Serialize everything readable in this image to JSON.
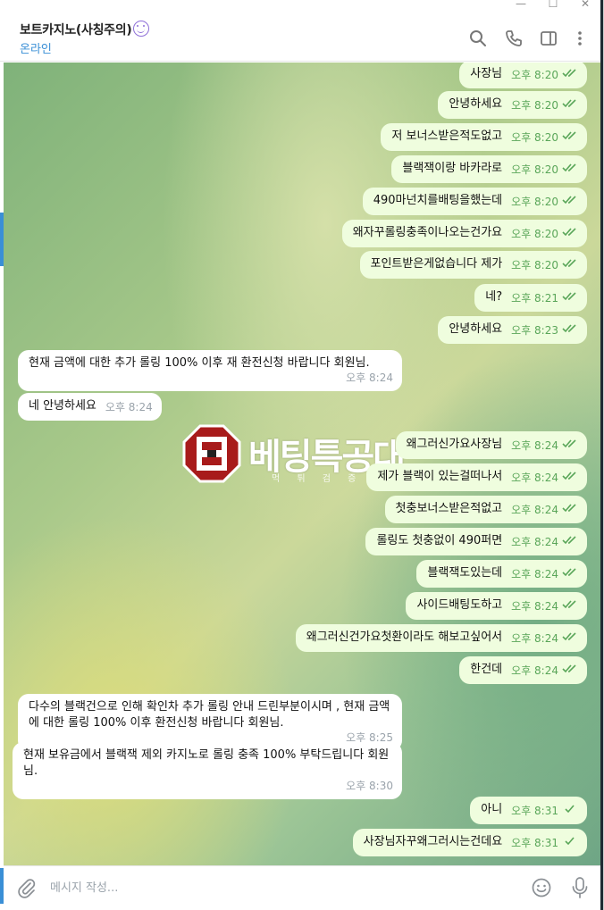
{
  "header": {
    "title": "보트카지노(사칭주의)",
    "status": "온라인",
    "icons": [
      "search-icon",
      "phone-icon",
      "sidebar-toggle-icon",
      "more-vertical-icon"
    ]
  },
  "watermark": {
    "text": "베팅특공대",
    "subtext": "먹 튀 검 증 의"
  },
  "messages": [
    {
      "dir": "out",
      "text": "사장님",
      "time": "오후 8:20",
      "read": true
    },
    {
      "dir": "out",
      "text": "안녕하세요",
      "time": "오후 8:20",
      "read": true
    },
    {
      "dir": "out",
      "text": "저 보너스받은적도없고",
      "time": "오후 8:20",
      "read": true
    },
    {
      "dir": "out",
      "text": "블랙잭이랑 바카라로",
      "time": "오후 8:20",
      "read": true
    },
    {
      "dir": "out",
      "text": "490마넌치를배팅을했는데",
      "time": "오후 8:20",
      "read": true
    },
    {
      "dir": "out",
      "text": "왜자꾸롤링충족이나오는건가요",
      "time": "오후 8:20",
      "read": true
    },
    {
      "dir": "out",
      "text": "포인트받은게없습니다 제가",
      "time": "오후 8:20",
      "read": true
    },
    {
      "dir": "out",
      "text": "네?",
      "time": "오후 8:21",
      "read": true
    },
    {
      "dir": "out",
      "text": "안녕하세요",
      "time": "오후 8:23",
      "read": true
    },
    {
      "dir": "in",
      "text": "현재 금액에 대한 추가 롤링 100% 이후 재 환전신청 바랍니다 회원님.",
      "time": "오후 8:24"
    },
    {
      "dir": "in",
      "text": "네 안녕하세요",
      "time": "오후 8:24"
    },
    {
      "dir": "out",
      "text": "왜그러신가요사장님",
      "time": "오후 8:24",
      "read": true
    },
    {
      "dir": "out",
      "text": "제가 블랙이 있는걸떠나서",
      "time": "오후 8:24",
      "read": true
    },
    {
      "dir": "out",
      "text": "첫충보너스받은적없고",
      "time": "오후 8:24",
      "read": true
    },
    {
      "dir": "out",
      "text": "롤링도 첫충없이 490퍼면",
      "time": "오후 8:24",
      "read": true
    },
    {
      "dir": "out",
      "text": "블랙잭도있는데",
      "time": "오후 8:24",
      "read": true
    },
    {
      "dir": "out",
      "text": "사이드배팅도하고",
      "time": "오후 8:24",
      "read": true
    },
    {
      "dir": "out",
      "text": "왜그러신건가요첫환이라도 해보고싶어서",
      "time": "오후 8:24",
      "read": true
    },
    {
      "dir": "out",
      "text": "한건데",
      "time": "오후 8:24",
      "read": true
    },
    {
      "dir": "in",
      "text": "다수의 블랙건으로 인해 확인차 추가 롤링 안내 드린부분이시며 , 현재 금액에 대한 롤링 100% 이후 환전신청 바랍니다 회원님.",
      "time": "오후 8:25"
    },
    {
      "dir": "in",
      "text": "현재 보유금에서 블랙잭 제외 카지노로 롤링 충족 100% 부탁드립니다 회원님.",
      "time": "오후 8:30"
    },
    {
      "dir": "out",
      "text": "아니",
      "time": "오후 8:31",
      "read": false
    },
    {
      "dir": "out",
      "text": "사장님자꾸왜그러시는건데요",
      "time": "오후 8:31",
      "read": false
    }
  ],
  "composer": {
    "placeholder": "메시지 작성...",
    "icons": [
      "paperclip-icon",
      "emoji-icon",
      "microphone-icon"
    ]
  },
  "colors": {
    "outgoing_bubble": "#effdde",
    "incoming_bubble": "#ffffff",
    "accent": "#3a8fd6",
    "time_out": "#5aa659"
  }
}
